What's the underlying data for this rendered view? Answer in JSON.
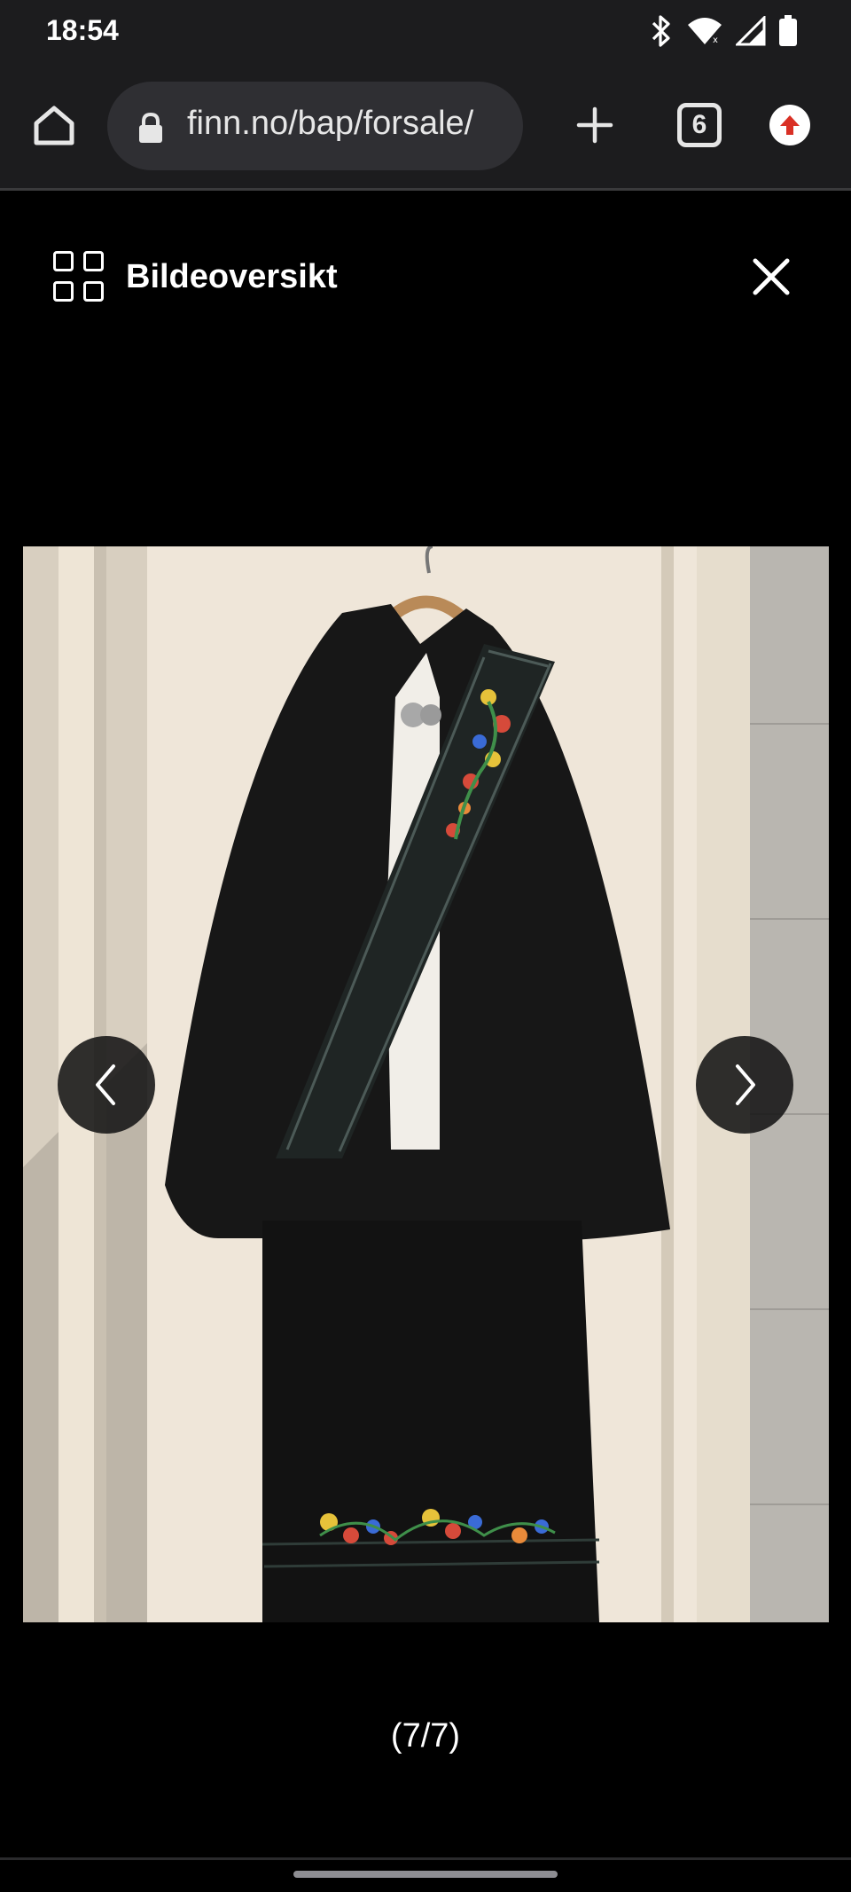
{
  "status_bar": {
    "time": "18:54",
    "icons": [
      "bluetooth-icon",
      "wifi-icon",
      "signal-icon",
      "battery-icon"
    ]
  },
  "browser": {
    "url": "finn.no/bap/forsale/",
    "tab_count": "6"
  },
  "viewer": {
    "title": "Bildeoversikt",
    "counter": "(7/7)"
  },
  "colors": {
    "accent_upload": "#d93025",
    "toolbar_bg": "#1c1c1e"
  }
}
